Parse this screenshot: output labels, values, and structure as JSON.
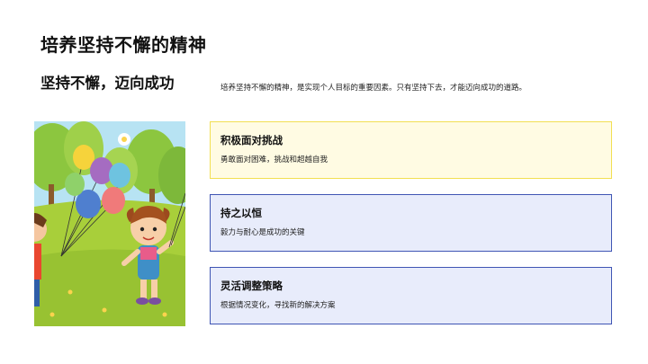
{
  "slide": {
    "title": "培养坚持不懈的精神",
    "subtitle": "坚持不懈，迈向成功",
    "intro": "培养坚持不懈的精神，是实现个人目标的重要因素。只有坚持下去，才能迈向成功的道路。"
  },
  "cards": [
    {
      "title": "积极面对挑战",
      "desc": "勇敢面对困难，挑战和超越自我",
      "bg": "#fffbe3",
      "border": "#f2df52"
    },
    {
      "title": "持之以恒",
      "desc": "毅力与耐心是成功的关键",
      "bg": "#e8ecfb",
      "border": "#3f55b4"
    },
    {
      "title": "灵活调整策略",
      "desc": "根据情况变化，寻找新的解决方案",
      "bg": "#e8ecfb",
      "border": "#3f55b4"
    }
  ],
  "illustration": {
    "icon": "kids-with-balloons-illustration"
  }
}
